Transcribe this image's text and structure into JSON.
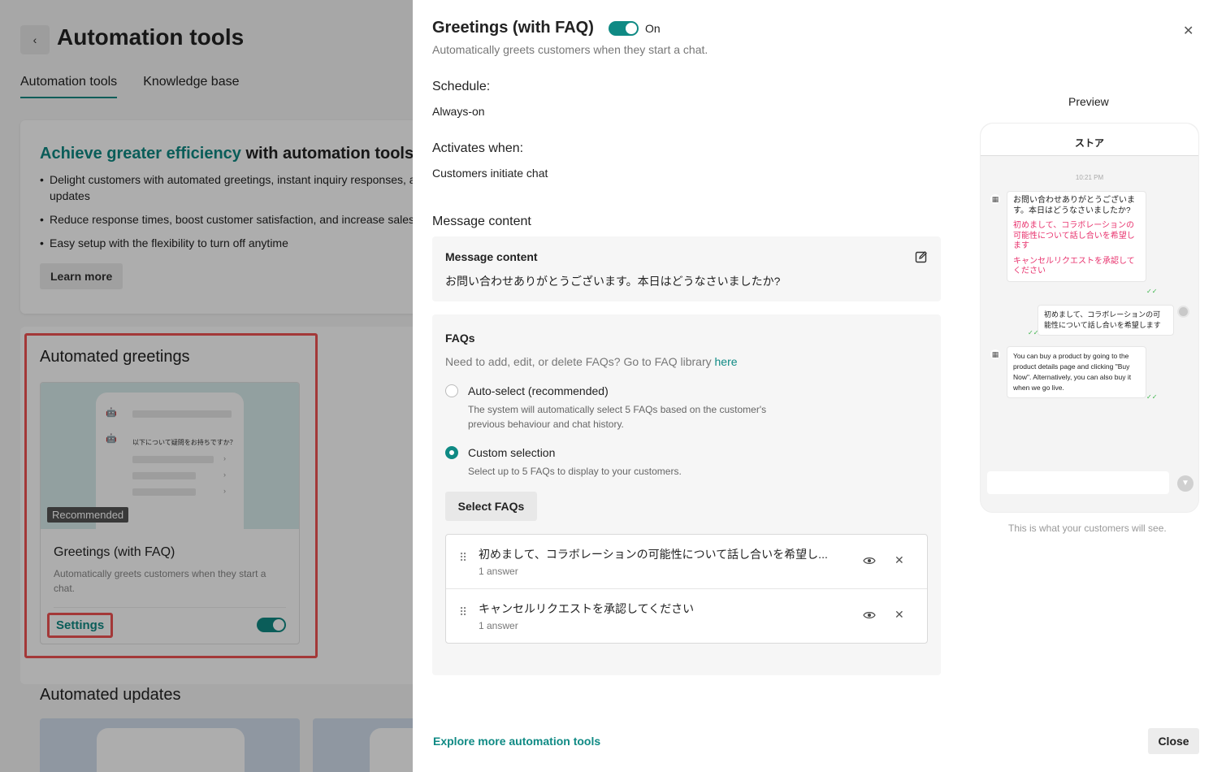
{
  "background": {
    "back_icon": "chevron-left-icon",
    "title": "Automation tools",
    "tabs": [
      {
        "label": "Automation tools",
        "active": true
      },
      {
        "label": "Knowledge base",
        "active": false
      }
    ],
    "promo": {
      "title_accent": "Achieve greater efficiency",
      "title_rest": " with automation tools",
      "bullets": [
        "Delight customers with automated greetings, instant inquiry responses, and order updates",
        "Reduce response times, boost customer satisfaction, and increase sales",
        "Easy setup with the flexibility to turn off anytime"
      ],
      "learn_more": "Learn more"
    },
    "greetings_section_title": "Automated greetings",
    "card": {
      "mini_question": "以下について疑問をお持ちですか？",
      "badge": "Recommended",
      "title": "Greetings (with FAQ)",
      "description": "Automatically greets customers when they start a chat.",
      "settings_label": "Settings",
      "enabled": true
    },
    "updates_section_title": "Automated updates"
  },
  "drawer": {
    "title": "Greetings (with FAQ)",
    "toggle_label": "On",
    "enabled": true,
    "subtitle": "Automatically greets customers when they start a chat.",
    "schedule_label": "Schedule:",
    "schedule_value": "Always-on",
    "activates_label": "Activates when:",
    "activates_value": "Customers initiate chat",
    "message_section_title": "Message content",
    "message_box_title": "Message content",
    "message_text": "お問い合わせありがとうございます。本日はどうなさいましたか?",
    "faqs_title": "FAQs",
    "faqs_help": "Need to add, edit, or delete FAQs? Go to FAQ library ",
    "faqs_help_link": "here",
    "options": [
      {
        "label": "Auto-select (recommended)",
        "desc": "The system will automatically select 5 FAQs based on the customer's previous behaviour and chat history.",
        "selected": false
      },
      {
        "label": "Custom selection",
        "desc": "Select up to 5 FAQs to display to your customers.",
        "selected": true
      }
    ],
    "select_faqs_label": "Select FAQs",
    "faq_items": [
      {
        "question": "初めまして、コラボレーションの可能性について話し合いを希望し...",
        "answers": "1 answer"
      },
      {
        "question": "キャンセルリクエストを承認してください",
        "answers": "1 answer"
      }
    ],
    "explore_link": "Explore more automation tools",
    "close_label": "Close",
    "preview": {
      "title": "Preview",
      "store_name": "ストア",
      "time": "10:21 PM",
      "greeting": "お問い合わせありがとうございます。本日はどうなさいましたか?",
      "faq_link_1": "初めまして、コラボレーションの可能性について話し合いを希望します",
      "faq_link_2": "キャンセルリクエストを承認してください",
      "user_message": "初めまして、コラボレーションの可能性について話し合いを希望します",
      "bot_reply": "You can buy a product by going to the product details page and clicking \"Buy Now\". Alternatively, you can also buy it when we go live.",
      "note": "This is what your customers will see."
    }
  },
  "colors": {
    "accent": "#0f8a84",
    "highlight": "#f05353",
    "faq_link": "#e8336e"
  }
}
